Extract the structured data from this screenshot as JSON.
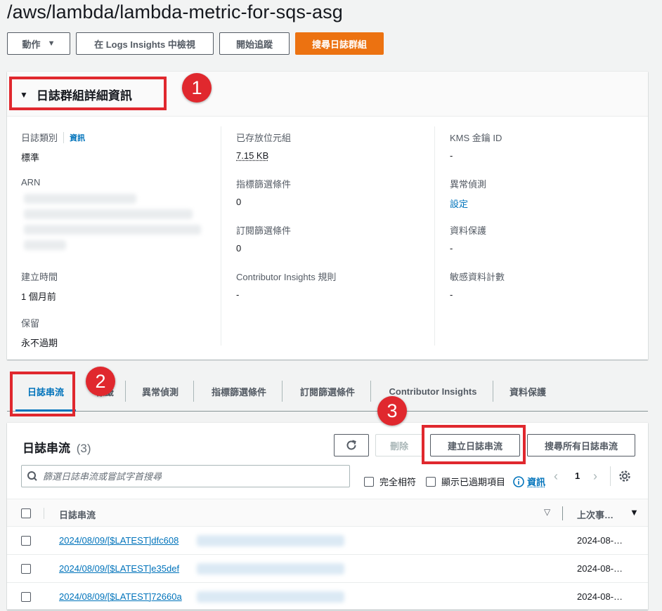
{
  "page": {
    "title": "/aws/lambda/lambda-metric-for-sqs-asg"
  },
  "toolbar": {
    "actions_label": "動作",
    "logs_insights_label": "在 Logs Insights 中檢視",
    "tail_label": "開始追蹤",
    "search_label": "搜尋日誌群組"
  },
  "annotations": {
    "badge1": "1",
    "badge2": "2",
    "badge3": "3"
  },
  "details": {
    "title": "日誌群組詳細資訊",
    "log_class_label": "日誌類別",
    "info_link": "資訊",
    "log_class_value": "標準",
    "arn_label": "ARN",
    "created_label": "建立時間",
    "created_value": "1 個月前",
    "retention_label": "保留",
    "retention_value": "永不過期",
    "stored_bytes_label": "已存放位元組",
    "stored_bytes_value": "7.15 KB",
    "metric_filters_label": "指標篩選條件",
    "metric_filters_value": "0",
    "subscription_filters_label": "訂閱篩選條件",
    "subscription_filters_value": "0",
    "contributor_rules_label": "Contributor Insights 規則",
    "contributor_rules_value": "-",
    "kms_label": "KMS 金鑰 ID",
    "kms_value": "-",
    "anomaly_label": "異常偵測",
    "anomaly_value": "設定",
    "data_protection_label": "資料保護",
    "data_protection_value": "-",
    "sensitive_count_label": "敏感資料計數",
    "sensitive_count_value": "-"
  },
  "tabs": [
    {
      "label": "日誌串流"
    },
    {
      "label": "標籤"
    },
    {
      "label": "異常偵測"
    },
    {
      "label": "指標篩選條件"
    },
    {
      "label": "訂閱篩選條件"
    },
    {
      "label": "Contributor Insights"
    },
    {
      "label": "資料保護"
    }
  ],
  "streams": {
    "title": "日誌串流",
    "count": "(3)",
    "delete_label": "刪除",
    "create_label": "建立日誌串流",
    "search_all_label": "搜尋所有日誌串流",
    "search_placeholder": "篩選日誌串流或嘗試字首搜尋",
    "exact_match_label": "完全相符",
    "show_expired_label": "顯示已過期項目",
    "info_label": "資訊",
    "page_number": "1",
    "col_stream": "日誌串流",
    "col_last_event": "上次事…",
    "rows": [
      {
        "name": "2024/08/09/[$LATEST]dfc608",
        "last_event": "2024-08-…"
      },
      {
        "name": "2024/08/09/[$LATEST]e35def",
        "last_event": "2024-08-…"
      },
      {
        "name": "2024/08/09/[$LATEST]72660a",
        "last_event": "2024-08-…"
      }
    ]
  },
  "colors": {
    "primary": "#ec7211",
    "link": "#0073bb",
    "annotation": "#e0282e"
  }
}
